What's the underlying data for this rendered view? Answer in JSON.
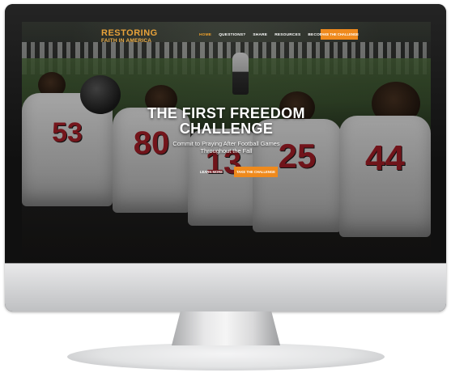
{
  "nav": {
    "logo_top": "RESTORING",
    "logo_bottom": "FAITH IN AMERICA",
    "links": [
      {
        "label": "HOME",
        "active": true
      },
      {
        "label": "QUESTIONS?",
        "active": false
      },
      {
        "label": "SHARE",
        "active": false
      },
      {
        "label": "RESOURCES",
        "active": false
      },
      {
        "label": "BECOME A PARTNER",
        "active": false
      }
    ],
    "cta_label": "TAKE THE CHALLENGE"
  },
  "hero": {
    "title_line1": "THE FIRST FREEDOM",
    "title_line2": "CHALLENGE",
    "subtitle_line1": "Commit to Praying After Football Games",
    "subtitle_line2": "Throughout the Fall",
    "learn_more_label": "LEARN MORE",
    "take_challenge_label": "TAKE THE CHALLENGE"
  },
  "photo": {
    "jersey_numbers": [
      "53",
      "80",
      "13",
      "25",
      "44"
    ]
  },
  "colors": {
    "accent": "#ef8a1d",
    "logo": "#e8a23a",
    "jersey_number": "#b3202a"
  }
}
